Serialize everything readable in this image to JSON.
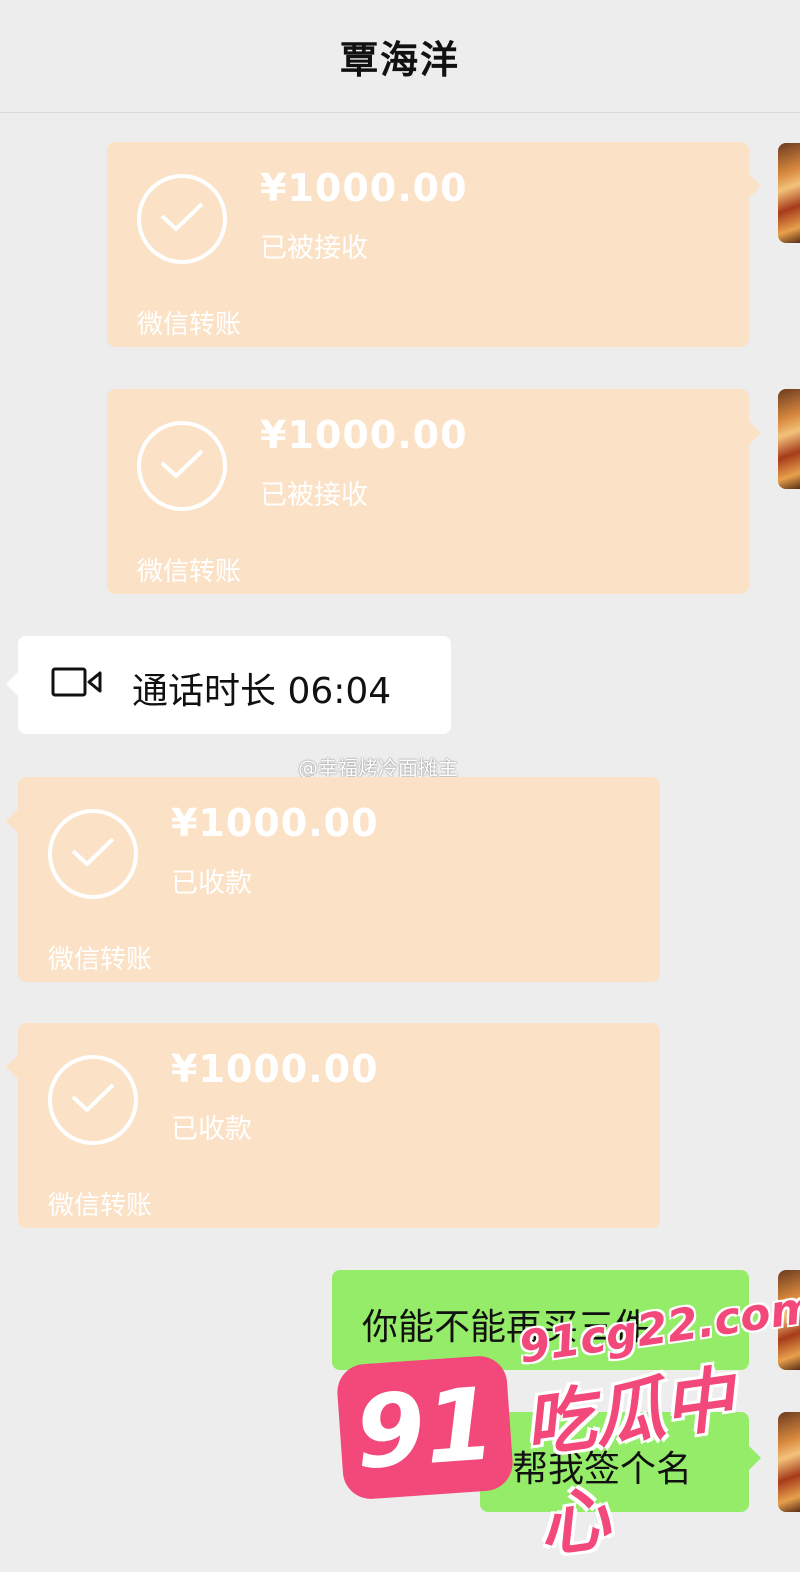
{
  "header": {
    "title": "覃海洋"
  },
  "transfers": [
    {
      "amount": "¥1000.00",
      "status": "已被接收",
      "label": "微信转账"
    },
    {
      "amount": "¥1000.00",
      "status": "已被接收",
      "label": "微信转账"
    },
    {
      "amount": "¥1000.00",
      "status": "已收款",
      "label": "微信转账"
    },
    {
      "amount": "¥1000.00",
      "status": "已收款",
      "label": "微信转账"
    }
  ],
  "call": {
    "text": "通话时长 06:04",
    "icon": "video-call-icon"
  },
  "weibo_watermark": "@幸福烤冷面摊主",
  "messages": [
    {
      "text": "你能不能再买三件"
    },
    {
      "text": "帮我签个名"
    }
  ],
  "watermark": {
    "number": "91",
    "domain": "91cg22.com",
    "name": "吃瓜中心"
  },
  "colors": {
    "transfer_bubble": "#fbe2c6",
    "sent_bubble": "#95ec69",
    "background": "#ededed",
    "watermark_pink": "#f2487a"
  }
}
